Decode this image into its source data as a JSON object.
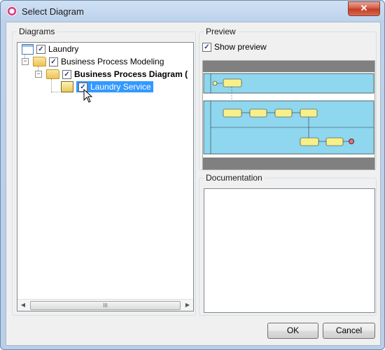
{
  "window": {
    "title": "Select Diagram",
    "close_label": "✕"
  },
  "diagrams": {
    "legend": "Diagrams",
    "tree": [
      {
        "label": "Laundry",
        "checked": true
      },
      {
        "label": "Business Process Modeling",
        "checked": true
      },
      {
        "label": "Business Process Diagram (",
        "checked": true
      },
      {
        "label": "Laundry Service",
        "checked": true
      }
    ],
    "check_mark": "✓",
    "expander_minus": "−",
    "scroll_left": "◀",
    "scroll_right": "▶",
    "scroll_grip": "III"
  },
  "preview": {
    "legend": "Preview",
    "show_preview_label": "Show preview",
    "show_preview_checked": true
  },
  "documentation": {
    "legend": "Documentation",
    "value": ""
  },
  "buttons": {
    "ok": "OK",
    "cancel": "Cancel"
  },
  "colors": {
    "pool_fill": "#8fd6ef",
    "task_fill": "#f7f08a",
    "band_gray": "#808080",
    "selection": "#3399ff"
  }
}
